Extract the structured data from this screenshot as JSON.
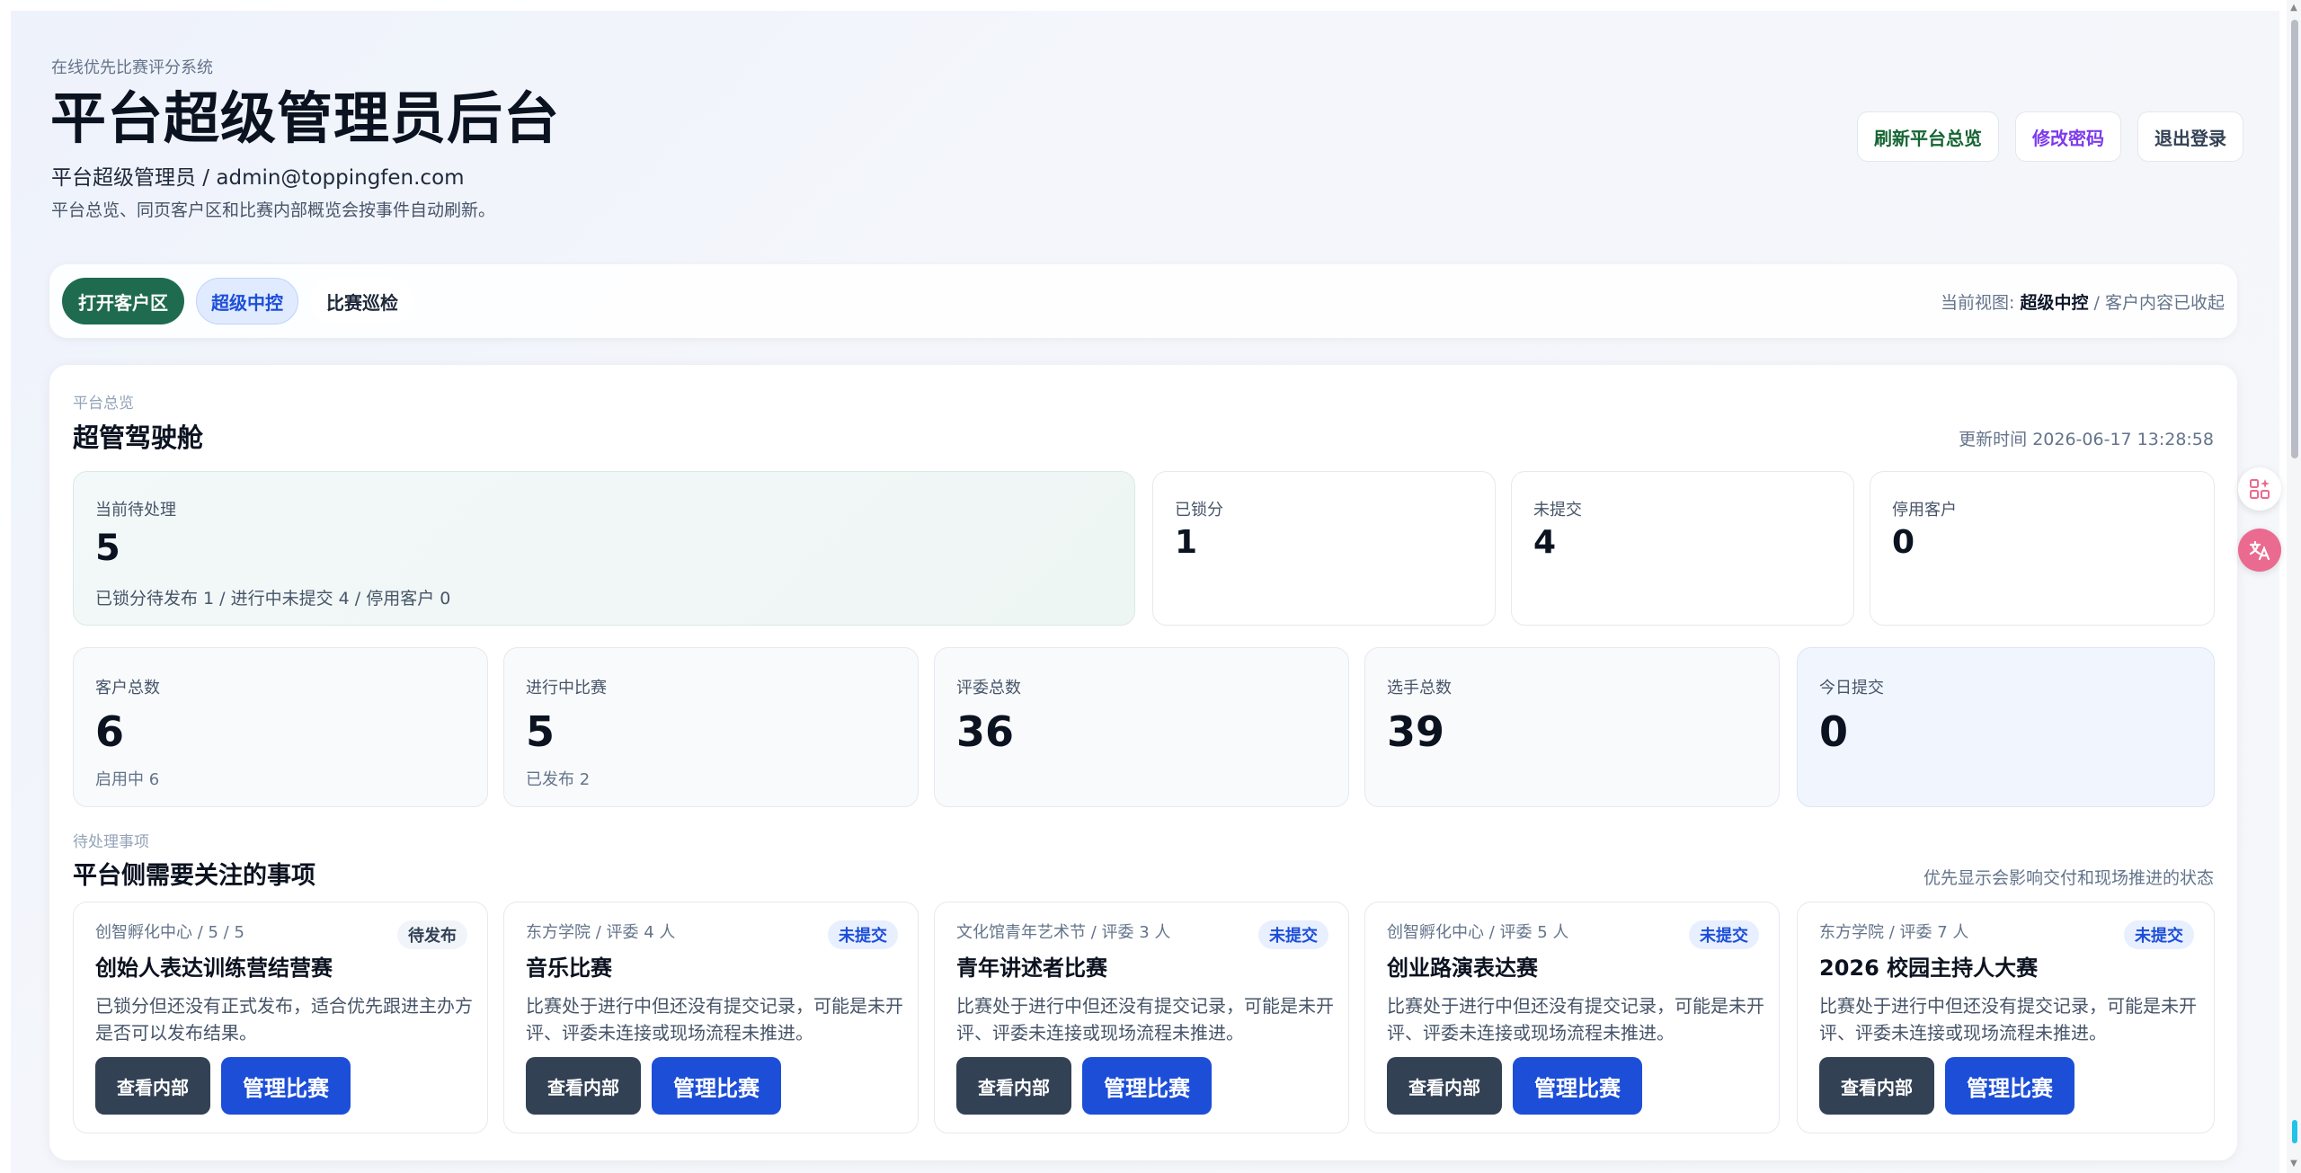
{
  "header": {
    "eyebrow": "在线优先比赛评分系统",
    "title": "平台超级管理员后台",
    "identity": "平台超级管理员 / admin@toppingfen.com",
    "description": "平台总览、同页客户区和比赛内部概览会按事件自动刷新。",
    "actions": {
      "refresh": "刷新平台总览",
      "change_password": "修改密码",
      "logout": "退出登录"
    }
  },
  "nav": {
    "open_client": "打开客户区",
    "super_control": "超级中控",
    "contest_inspect": "比赛巡检",
    "view_prefix": "当前视图:",
    "view_current": "超级中控",
    "view_suffix": " / 客户内容已收起"
  },
  "overview": {
    "eyebrow": "平台总览",
    "title": "超管驾驶舱",
    "updated": "更新时间 2026-06-17 13:28:58",
    "pending": {
      "label": "当前待处理",
      "value": "5",
      "sub": "已锁分待发布 1 / 进行中未提交 4 / 停用客户 0"
    },
    "locked": {
      "label": "已锁分",
      "value": "1"
    },
    "unsubmitted": {
      "label": "未提交",
      "value": "4"
    },
    "disabled_clients": {
      "label": "停用客户",
      "value": "0"
    },
    "clients_total": {
      "label": "客户总数",
      "value": "6",
      "sub": "启用中 6"
    },
    "running": {
      "label": "进行中比赛",
      "value": "5",
      "sub": "已发布 2"
    },
    "judges_total": {
      "label": "评委总数",
      "value": "36"
    },
    "players_total": {
      "label": "选手总数",
      "value": "39"
    },
    "today_submit": {
      "label": "今日提交",
      "value": "0"
    }
  },
  "tasks": {
    "eyebrow": "待处理事项",
    "title": "平台侧需要关注的事项",
    "hint": "优先显示会影响交付和现场推进的状态",
    "view_inside": "查看内部",
    "manage": "管理比赛",
    "items": [
      {
        "meta": "创智孵化中心 / 5 / 5",
        "badge": "待发布",
        "name": "创始人表达训练营结营赛",
        "desc": "已锁分但还没有正式发布，适合优先跟进主办方是否可以发布结果。"
      },
      {
        "meta": "东方学院 / 评委 4 人",
        "badge": "未提交",
        "name": "音乐比赛",
        "desc": "比赛处于进行中但还没有提交记录，可能是未开评、评委未连接或现场流程未推进。"
      },
      {
        "meta": "文化馆青年艺术节 / 评委 3 人",
        "badge": "未提交",
        "name": "青年讲述者比赛",
        "desc": "比赛处于进行中但还没有提交记录，可能是未开评、评委未连接或现场流程未推进。"
      },
      {
        "meta": "创智孵化中心 / 评委 5 人",
        "badge": "未提交",
        "name": "创业路演表达赛",
        "desc": "比赛处于进行中但还没有提交记录，可能是未开评、评委未连接或现场流程未推进。"
      },
      {
        "meta": "东方学院 / 评委 7 人",
        "badge": "未提交",
        "name": "2026 校园主持人大赛",
        "desc": "比赛处于进行中但还没有提交记录，可能是未开评、评委未连接或现场流程未推进。"
      }
    ]
  },
  "icons": [
    "apps-sparkle-icon",
    "translate-icon"
  ],
  "colors": {
    "primary_green": "#1f6b4f",
    "primary_blue": "#1d4ed8",
    "dark_slate": "#334155"
  }
}
